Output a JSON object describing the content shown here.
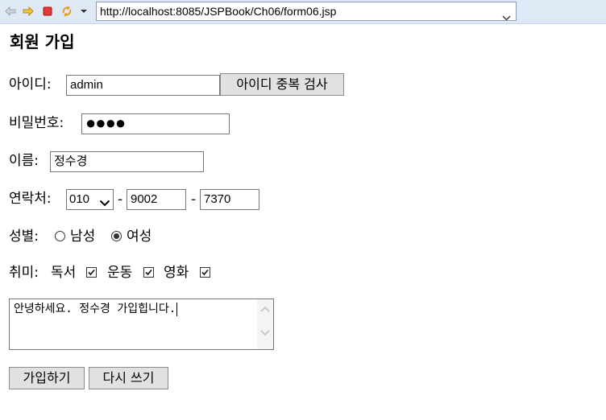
{
  "browser": {
    "url": "http://localhost:8085/JSPBook/Ch06/form06.jsp",
    "icons": [
      "back-arrow-icon",
      "forward-arrow-icon",
      "stop-icon",
      "refresh-icon",
      "dropdown-arrow-icon"
    ]
  },
  "form": {
    "title": "회원 가입",
    "id": {
      "label": "아이디:",
      "value": "admin",
      "check_button": "아이디 중복 검사"
    },
    "password": {
      "label": "비밀번호:",
      "masked": "●●●●"
    },
    "name": {
      "label": "이름:",
      "value": "정수경"
    },
    "phone": {
      "label": "연락처:",
      "prefix": "010",
      "sep1": "-",
      "middle": "9002",
      "sep2": "-",
      "last": "7370"
    },
    "gender": {
      "label": "성별:",
      "options": [
        {
          "label": "남성",
          "checked": false
        },
        {
          "label": "여성",
          "checked": true
        }
      ]
    },
    "hobby": {
      "label": "취미:",
      "options": [
        {
          "label": "독서",
          "checked": true
        },
        {
          "label": "운동",
          "checked": true
        },
        {
          "label": "영화",
          "checked": true
        }
      ]
    },
    "comment": "안녕하세요. 정수경 가입힙니다.",
    "submit_button": "가입하기",
    "reset_button": "다시 쓰기"
  }
}
